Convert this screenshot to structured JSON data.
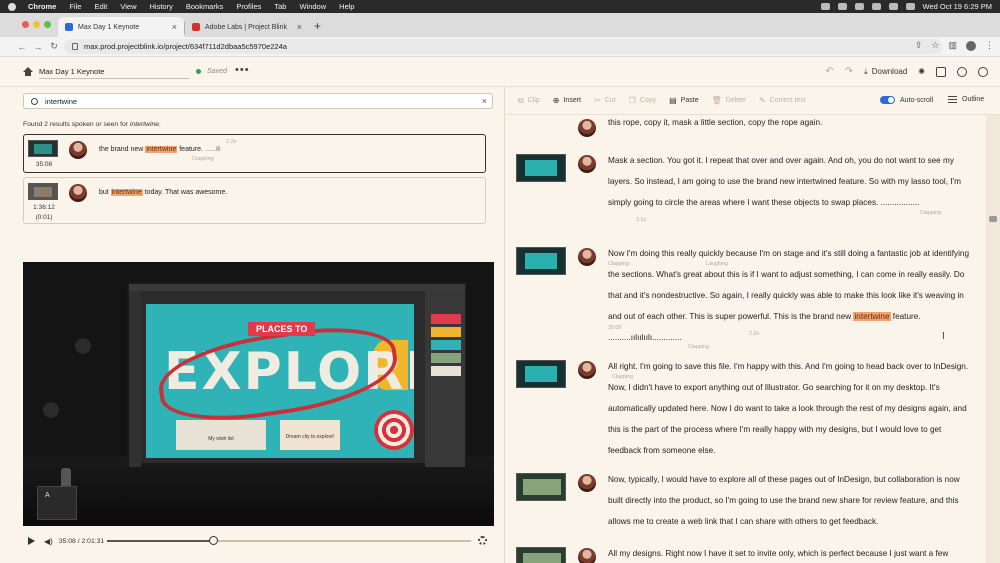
{
  "menubar": {
    "app": "Chrome",
    "items": [
      "File",
      "Edit",
      "View",
      "History",
      "Bookmarks",
      "Profiles",
      "Tab",
      "Window",
      "Help"
    ],
    "datetime": "Wed Oct 19  6:29 PM"
  },
  "tabs": [
    {
      "title": "Max Day 1 Keynote",
      "color": "#2a6bd6"
    },
    {
      "title": "Adobe Labs | Project Blink",
      "color": "#d6302b"
    }
  ],
  "browser": {
    "url": "max.prod.projectblink.io/project/634f711d2dbaa5c5970e224a"
  },
  "app": {
    "project_title": "Max Day 1 Keynote",
    "saved_label": "Saved",
    "download_label": "Download"
  },
  "search": {
    "query": "intertwine",
    "found_prefix": "Found 2 results spoken or seen for ",
    "found_term": "intertwine",
    "found_suffix": "."
  },
  "results": [
    {
      "time": "35:08",
      "sub": "",
      "before": "the brand new ",
      "match": "intertwine",
      "after": " feature.",
      "wave": "...........ılıllı",
      "note": "Clapping",
      "dur": "2.2s"
    },
    {
      "time": "1:36:12",
      "sub": "(0:01)",
      "before": "but ",
      "match": "intertwine",
      "after": " today. That was awesome.",
      "wave": "",
      "note": "",
      "dur": ""
    }
  ],
  "video": {
    "artboard_tag": "PLACES TO",
    "artboard_title": "EXPLORE",
    "wish_card": "My wish list",
    "dream_card": "Dream city to explore!",
    "podium_logo": "A"
  },
  "player": {
    "current": "35:08",
    "total": "2:01:31",
    "time_display": "35:08 / 2:01:31",
    "progress": 0.29
  },
  "toolbar": {
    "clip": "Clip",
    "insert": "Insert",
    "cut": "Cut",
    "copy": "Copy",
    "paste": "Paste",
    "delete": "Delete",
    "correct": "Correct text",
    "autoscroll": "Auto-scroll",
    "outline": "Outline"
  },
  "transcript": [
    {
      "text": "they're all weaving in and out of each other in order to get that effect today, I would, you know, take this rope, copy it, mask a little section, copy the rope again."
    },
    {
      "text": "Mask a section. You got it. I repeat that over and over again. And oh, you do not want to see my layers. So instead, I am going to use the brand new intertwined feature. So with my lasso tool, I'm simply going to circle the areas where I want these objects to swap places. .................",
      "note1": "Clapping",
      "dur1": "3.1s"
    },
    {
      "before": "Now I'm doing this really quickly because I'm on stage and it's still doing a fantastic job at identifying the sections. What's great about this is if I want to adjust something, I can come in really easily. Do that and it's nondestructive. So again, I really quickly was able to make this look like it's weaving in and out of each other. This is super powerful. This is the brand new ",
      "match": "intertwine",
      "after": " feature. ..........ıılıılıılı.............",
      "note_a": "Clapping",
      "note_b": "Laughing",
      "time": "35:08",
      "note_c": "Clapping",
      "dur": "2.2s"
    },
    {
      "text": "All right. I'm going to save this file. I'm happy with this. And I'm going to head back over to InDesign. Now, I didn't have to export anything out of Illustrator. Go searching for it on my desktop. It's automatically updated here. Now I do want to take a look through the rest of my designs again, and this is the part of the process where I'm really happy with my designs, but I would love to get feedback from someone else.",
      "note": "Clapping"
    },
    {
      "text": "Now, typically, I would have to explore all of these pages out of InDesign, but collaboration is now built directly into the product, so I'm going to use the brand new share for review feature, and this allows me to create a web link that I can share with others to get feedback."
    },
    {
      "text": "All my designs. Right now I have it set to invite only, which is perfect because I just want a few"
    }
  ],
  "colors": {
    "highlight": "#f1a36f",
    "accent": "#2a6bd6",
    "background": "#fbf4ea"
  }
}
